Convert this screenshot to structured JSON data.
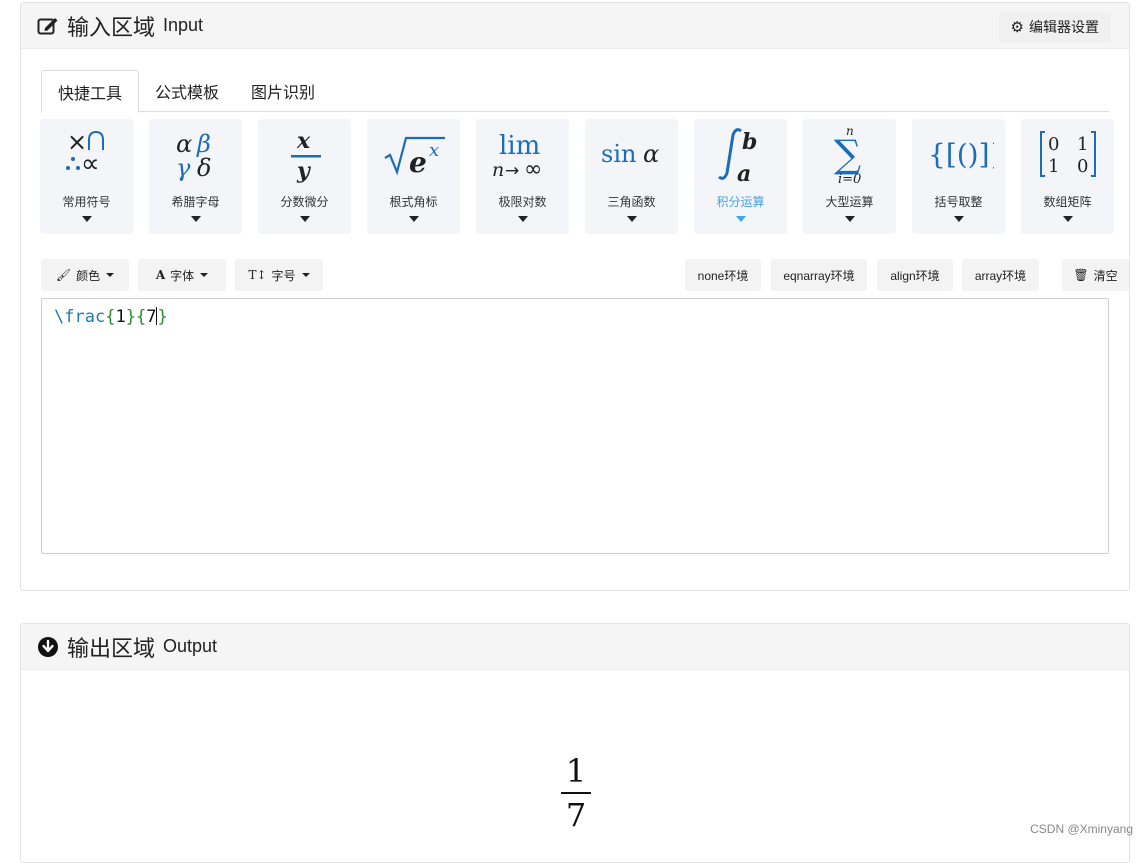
{
  "input_panel": {
    "title_zh": "输入区域",
    "title_en": "Input",
    "settings_label": "编辑器设置"
  },
  "tabs": [
    {
      "label": "快捷工具",
      "active": true
    },
    {
      "label": "公式模板",
      "active": false
    },
    {
      "label": "图片识别",
      "active": false
    }
  ],
  "tools": [
    {
      "label": "常用符号"
    },
    {
      "label": "希腊字母"
    },
    {
      "label": "分数微分"
    },
    {
      "label": "根式角标"
    },
    {
      "label": "极限对数"
    },
    {
      "label": "三角函数"
    },
    {
      "label": "积分运算",
      "active": true
    },
    {
      "label": "大型运算"
    },
    {
      "label": "括号取整"
    },
    {
      "label": "数组矩阵"
    }
  ],
  "toolbar": {
    "color": "颜色",
    "font": "字体",
    "size": "字号",
    "env_none": "none环境",
    "env_eqnarray": "eqnarray环境",
    "env_align": "align环境",
    "env_array": "array环境",
    "clear": "清空"
  },
  "editor": {
    "cmd": "\\frac",
    "open1": "{",
    "arg1": "1",
    "close1": "}",
    "open2": "{",
    "arg2": "7",
    "close2": "}"
  },
  "output_panel": {
    "title_zh": "输出区域",
    "title_en": "Output",
    "numerator": "1",
    "denominator": "7"
  },
  "watermark": "CSDN @Xminyang"
}
